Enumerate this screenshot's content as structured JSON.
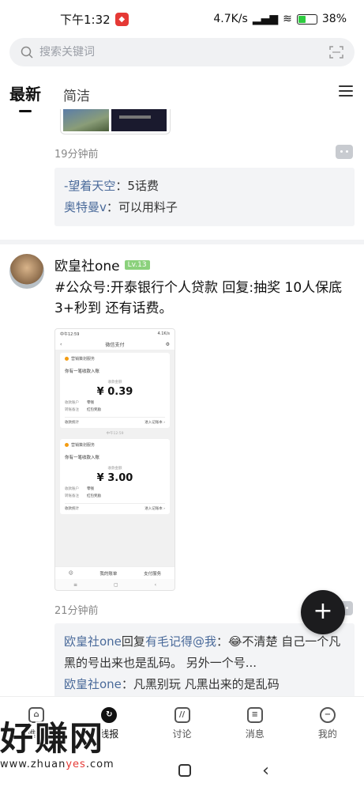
{
  "status": {
    "time": "下午1:32",
    "net_speed": "4.7K/s",
    "battery": "38%",
    "battery_level": 0.38
  },
  "search": {
    "placeholder": "搜索关键词"
  },
  "tabs": [
    {
      "label": "最新",
      "active": true
    },
    {
      "label": "简洁",
      "active": false
    }
  ],
  "posts": [
    {
      "time": "19分钟前",
      "replies": [
        {
          "user": "-望着天空",
          "text": "：5话费"
        },
        {
          "user": "奥特曼v",
          "text": "：可以用料子"
        }
      ]
    },
    {
      "author": "欧皇社one",
      "level": "Lv.13",
      "text": "#公众号:开泰银行个人贷款 回复:抽奖 10人保底3+秒到 还有话费。",
      "time": "21分钟前",
      "screenshot": {
        "status_time": "中午12:59",
        "status_right": "4.1K/s",
        "title": "微信支付",
        "service": "营销策划服务",
        "received_title": "你有一笔收款入账",
        "amount_label": "收款金额",
        "amount1": "¥ 0.39",
        "amount2": "¥ 3.00",
        "payer_label": "收款账户",
        "payer_value": "零钱",
        "remark_label": "转账备注",
        "remark_value": "红包奖励",
        "stat_label": "收款统计",
        "stat_link": "进入记账本 ›",
        "time_mark": "中午12:59",
        "bottom_left": "我的账单",
        "bottom_right": "支付服务"
      },
      "replies": [
        {
          "user": "欧皇社one",
          "mid": "回复",
          "target": "有毛记得@我",
          "text": "：😂不清楚 自己一个凡黑的号出来也是乱码。 另外一个号..."
        },
        {
          "user": "欧皇社one",
          "text": "：凡黑别玩 凡黑出来的是乱码"
        }
      ]
    }
  ],
  "fab_label": "+",
  "bottom_nav": [
    {
      "label": "推荐",
      "icon": "home-icon"
    },
    {
      "label": "线报",
      "icon": "refresh-icon"
    },
    {
      "label": "讨论",
      "icon": "discuss-icon"
    },
    {
      "label": "消息",
      "icon": "message-icon"
    },
    {
      "label": "我的",
      "icon": "profile-icon"
    }
  ],
  "watermark": {
    "text": "好赚网",
    "url_pre": "www.zhuan",
    "url_mid": "yes",
    "url_post": ".com"
  }
}
